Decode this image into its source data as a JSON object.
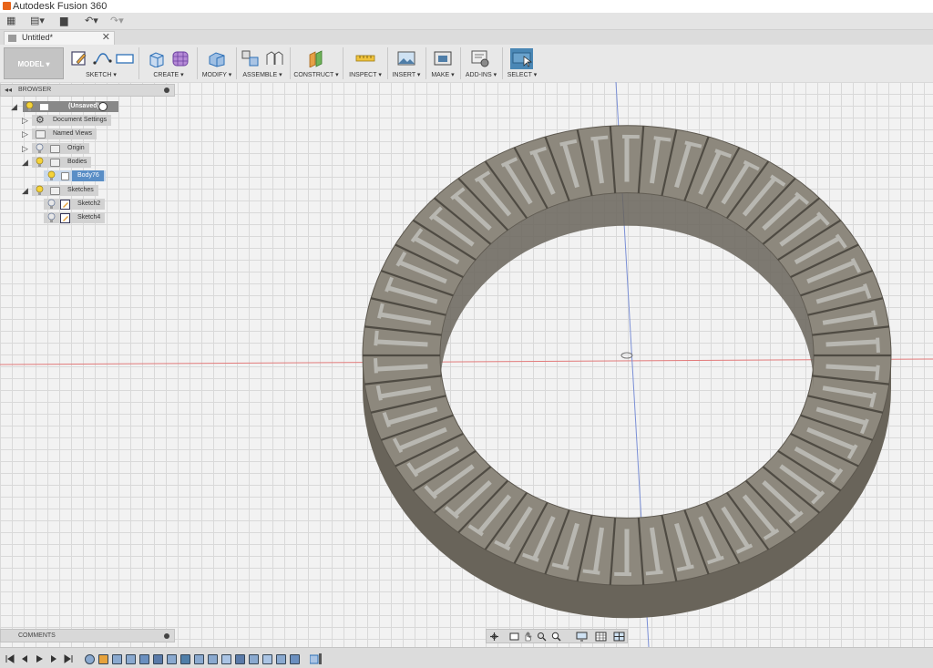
{
  "app": {
    "title": "Autodesk Fusion 360"
  },
  "document_tab": {
    "title": "Untitled*",
    "close": "✕"
  },
  "qat": {
    "grid": "▦",
    "file": "▤▾",
    "save": "▆",
    "undo": "↶▾",
    "redo": "↷▾"
  },
  "toolbar": {
    "workspace": "MODEL",
    "groups": [
      {
        "label": "SKETCH"
      },
      {
        "label": "CREATE"
      },
      {
        "label": "MODIFY"
      },
      {
        "label": "ASSEMBLE"
      },
      {
        "label": "CONSTRUCT"
      },
      {
        "label": "INSPECT"
      },
      {
        "label": "INSERT"
      },
      {
        "label": "MAKE"
      },
      {
        "label": "ADD-INS"
      },
      {
        "label": "SELECT"
      }
    ]
  },
  "browser": {
    "header": "BROWSER",
    "collapse": "◂◂",
    "root": "(Unsaved)",
    "items": {
      "document_settings": "Document Settings",
      "named_views": "Named Views",
      "origin": "Origin",
      "bodies": "Bodies",
      "body": "Body76",
      "sketches": "Sketches",
      "sketch2": "Sketch2",
      "sketch4": "Sketch4"
    }
  },
  "comments": {
    "label": "COMMENTS"
  },
  "colors": {
    "ring_top": "#8d887d",
    "ring_side": "#69645a",
    "slot": "#b8b7b1",
    "accent": "#5a8ec6",
    "x_axis": "#e27a7a",
    "y_axis": "#7a8fd6"
  },
  "model": {
    "segments": 50
  }
}
